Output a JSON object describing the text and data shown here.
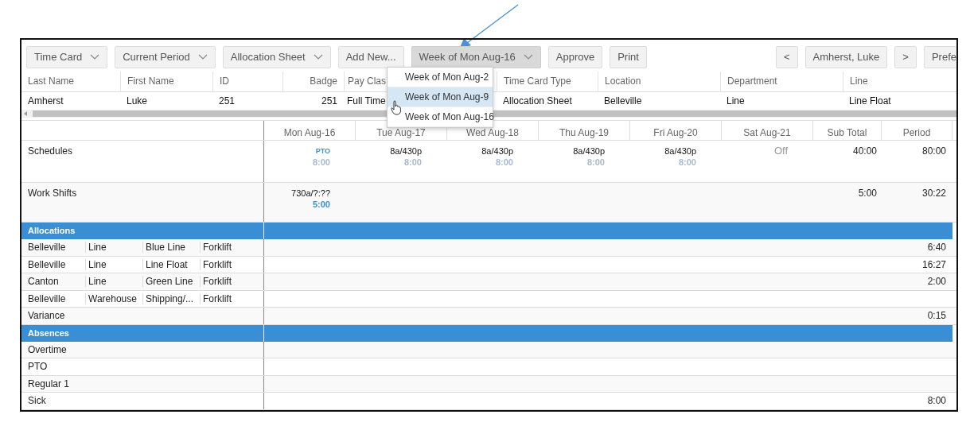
{
  "toolbar": {
    "buttons": [
      {
        "label": "Time Card",
        "kind": "dropdown",
        "pressed": false
      },
      {
        "label": "Current Period",
        "kind": "dropdown",
        "pressed": false
      },
      {
        "label": "Allocation Sheet",
        "kind": "dropdown",
        "pressed": false
      },
      {
        "label": "Add New...",
        "kind": "button",
        "pressed": false
      },
      {
        "label": "Week of Mon Aug-16",
        "kind": "dropdown",
        "pressed": true
      },
      {
        "label": "Approve",
        "kind": "button",
        "pressed": false
      },
      {
        "label": "Print",
        "kind": "button",
        "pressed": false
      }
    ],
    "right_buttons": [
      {
        "label": "<"
      },
      {
        "label": "Amherst, Luke"
      },
      {
        "label": ">"
      },
      {
        "label": "Prefe"
      }
    ]
  },
  "dropdown_menu": {
    "items": [
      {
        "label": "Week of Mon Aug-2",
        "selected": false
      },
      {
        "label": "Week of Mon Aug-9",
        "selected": true
      },
      {
        "label": "Week of Mon Aug-16",
        "selected": false
      }
    ]
  },
  "employee_table": {
    "columns": [
      {
        "label": "Last Name"
      },
      {
        "label": "First Name"
      },
      {
        "label": "ID"
      },
      {
        "label": "Badge"
      },
      {
        "label": "Pay Clas"
      },
      {
        "label": "Time Card Type"
      },
      {
        "label": "Location"
      },
      {
        "label": "Department"
      },
      {
        "label": "Line"
      }
    ],
    "rows": [
      [
        "Amherst",
        "Luke",
        "251",
        "251",
        "Full Time",
        "Allocation Sheet",
        "Belleville",
        "Line",
        "Line Float"
      ]
    ]
  },
  "timesheet": {
    "columns": [
      "Mon Aug-16",
      "Tue Aug-17",
      "Wed Aug-18",
      "Thu Aug-19",
      "Fri Aug-20",
      "Sat Aug-21",
      "Sub Total",
      "Period"
    ],
    "rows": [
      {
        "label": "Schedules",
        "kind": "schedule",
        "cells": [
          {
            "kind": "code",
            "text": "PTO",
            "hours": "8:00"
          },
          {
            "kind": "shift",
            "text": "8a/430p",
            "hours": "8:00"
          },
          {
            "kind": "shift",
            "text": "8a/430p",
            "hours": "8:00"
          },
          {
            "kind": "shift",
            "text": "8a/430p",
            "hours": "8:00"
          },
          {
            "kind": "shift",
            "text": "8a/430p",
            "hours": "8:00"
          },
          {
            "kind": "off",
            "text": "Off"
          }
        ],
        "sub_total": "40:00",
        "period": "80:00"
      },
      {
        "label": "Work Shifts",
        "kind": "actual",
        "cells": [
          {
            "kind": "shift",
            "text": "730a/?:??",
            "hours": "5:00"
          },
          null,
          null,
          null,
          null,
          null
        ],
        "sub_total": "5:00",
        "period": "30:22"
      }
    ],
    "sections": [
      {
        "title": "Allocations",
        "rows": [
          {
            "kind": "allocation",
            "fields": [
              "Belleville",
              "Line",
              "Blue Line",
              "Forklift"
            ],
            "period": "6:40"
          },
          {
            "kind": "allocation",
            "fields": [
              "Belleville",
              "Line",
              "Line Float",
              "Forklift"
            ],
            "period": "16:27"
          },
          {
            "kind": "allocation",
            "fields": [
              "Canton",
              "Line",
              "Green Line",
              "Forklift"
            ],
            "period": "2:00"
          },
          {
            "kind": "allocation",
            "fields": [
              "Belleville",
              "Warehouse",
              "Shipping/...",
              "Forklift"
            ]
          },
          {
            "kind": "line",
            "label": "Variance",
            "period": "0:15"
          }
        ]
      },
      {
        "title": "Absences",
        "rows": [
          {
            "kind": "line",
            "label": "Overtime"
          },
          {
            "kind": "line",
            "label": "PTO"
          },
          {
            "kind": "line",
            "label": "Regular 1"
          },
          {
            "kind": "line",
            "label": "Sick",
            "period": "8:00"
          }
        ]
      }
    ]
  }
}
